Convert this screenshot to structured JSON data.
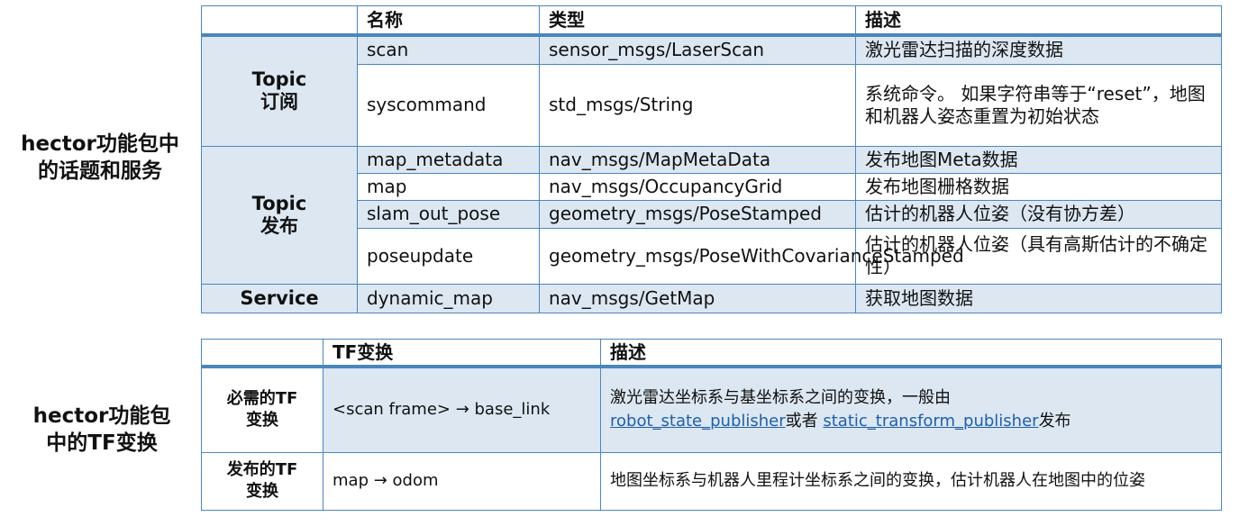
{
  "left_titles": {
    "title1": [
      "hector功能包中",
      "的话题和服务"
    ],
    "title2": [
      "hector功能包",
      "中的TF变换"
    ]
  },
  "topics_table": {
    "headers": [
      "",
      "名称",
      "类型",
      "描述"
    ],
    "groups": [
      {
        "label": [
          "Topic",
          "订阅"
        ],
        "rows": [
          {
            "name": "scan",
            "type": "sensor_msgs/LaserScan",
            "desc": "激光雷达扫描的深度数据"
          },
          {
            "name": "syscommand",
            "type": "std_msgs/String",
            "desc": "系统命令。 如果字符串等于“reset”，地图和机器人姿态重置为初始状态"
          }
        ]
      },
      {
        "label": [
          "Topic",
          "发布"
        ],
        "rows": [
          {
            "name": "map_metadata",
            "type": "nav_msgs/MapMetaData",
            "desc": "发布地图Meta数据"
          },
          {
            "name": "map",
            "type": "nav_msgs/OccupancyGrid",
            "desc": "发布地图栅格数据"
          },
          {
            "name": "slam_out_pose",
            "type": "geometry_msgs/PoseStamped",
            "desc": "估计的机器人位姿（没有协方差）"
          },
          {
            "name": "poseupdate",
            "type": "geometry_msgs/PoseWithCovarianceStamped",
            "desc": "估计的机器人位姿（具有高斯估计的不确定性）"
          }
        ]
      },
      {
        "label": [
          "Service"
        ],
        "rows": [
          {
            "name": "dynamic_map",
            "type": "nav_msgs/GetMap",
            "desc": "获取地图数据"
          }
        ]
      }
    ]
  },
  "tf_table": {
    "headers": [
      "",
      "TF变换",
      "描述"
    ],
    "rows": [
      {
        "label": [
          "必需的TF",
          "变换"
        ],
        "transform": "<scan frame> → base_link",
        "desc_text": "激光雷达坐标系与基坐标系之间的变换，一般由",
        "link1": "robot_state_publisher",
        "connector": "或者",
        "link2": "static_transform_publisher",
        "suffix": "发布"
      },
      {
        "label": [
          "发布的TF",
          "变换"
        ],
        "transform": "map → odom",
        "desc_text": "地图坐标系与机器人里程计坐标系之间的变换，估计机器人在地图中的位姿"
      }
    ]
  }
}
